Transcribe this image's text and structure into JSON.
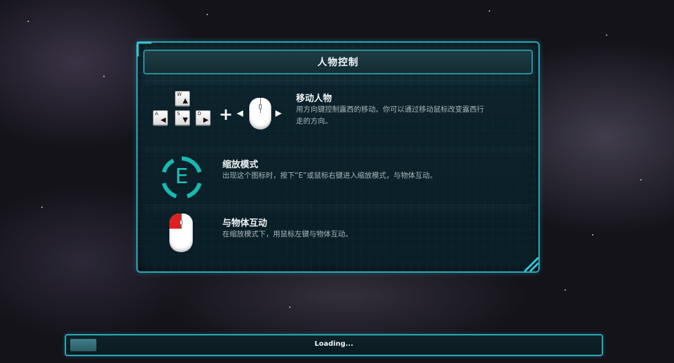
{
  "panel": {
    "title": "人物控制",
    "rows": [
      {
        "heading": "移动人物",
        "desc_line1": "用方向键控制露西的移动。你可以通过移动鼠标改变露西行",
        "desc_line2": "走的方向。",
        "keys": {
          "up": "W",
          "left": "A",
          "down": "S",
          "right": "D"
        }
      },
      {
        "heading": "缩放模式",
        "desc": "出现这个图标时，按下“E”或鼠标右键进入缩放模式，与物体互动。",
        "icon_letter": "E"
      },
      {
        "heading": "与物体互动",
        "desc": "在缩放模式下，用鼠标左键与物体互动。"
      }
    ]
  },
  "loading": {
    "label": "Loading...",
    "progress": 0.05
  },
  "colors": {
    "accent": "#2aa7b7",
    "zoom_icon": "#19b8b0",
    "mouse_highlight": "#e02020"
  },
  "icons": [
    "wasd-keys-icon",
    "mouse-icon",
    "zoom-e-icon",
    "left-click-mouse-icon"
  ]
}
